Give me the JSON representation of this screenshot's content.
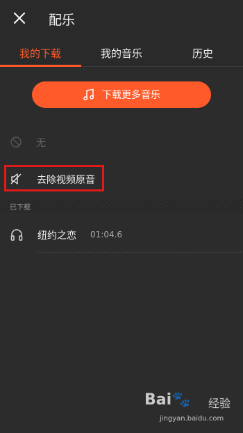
{
  "header": {
    "title": "配乐",
    "close_icon": "close-icon"
  },
  "tabs": [
    {
      "label": "我的下载",
      "active": true
    },
    {
      "label": "我的音乐",
      "active": false
    },
    {
      "label": "历史",
      "active": false
    }
  ],
  "download_more": {
    "label": "下载更多音乐",
    "icon": "music-note-icon"
  },
  "options": {
    "none_label": "无",
    "remove_original_label": "去除视频原音"
  },
  "downloaded_section": {
    "title": "已下载"
  },
  "tracks": [
    {
      "name": "纽约之恋",
      "duration": "01:04.6"
    }
  ],
  "watermark": {
    "brand": "Bai🐾",
    "brand2": "经验",
    "url": "jingyan.baidu.com"
  },
  "colors": {
    "accent": "#ff5a2a",
    "background": "#2c2c2c",
    "highlight_box": "#e01a1a"
  }
}
